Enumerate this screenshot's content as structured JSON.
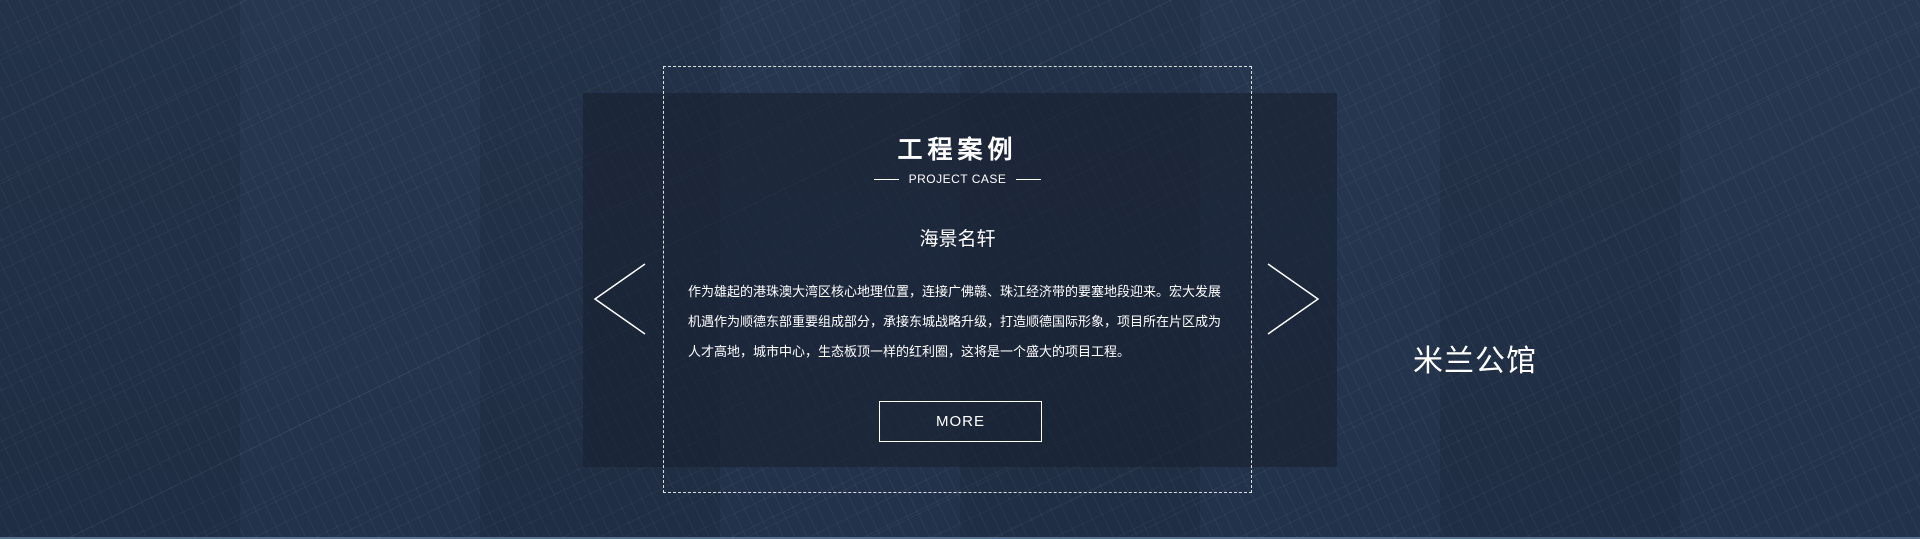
{
  "section": {
    "title": "工程案例",
    "subtitle": "PROJECT CASE"
  },
  "current_project": {
    "name": "海景名轩",
    "description": "作为雄起的港珠澳大湾区核心地理位置，连接广佛赣、珠江经济带的要塞地段迎来。宏大发展机遇作为顺德东部重要组成部分，承接东城战略升级，打造顺德国际形象，项目所在片区成为人才高地，城市中心，生态板顶一样的红利圈，这将是一个盛大的项目工程。",
    "more_label": "MORE"
  },
  "next_project": {
    "name": "米兰公馆"
  },
  "controls": {
    "prev_icon": "chevron-left-icon",
    "next_icon": "chevron-right-icon"
  },
  "colors": {
    "background": "#253650",
    "panel": "#19212f",
    "text": "#ffffff"
  }
}
